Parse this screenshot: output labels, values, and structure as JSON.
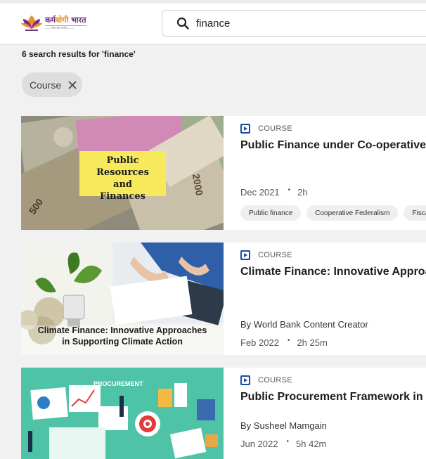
{
  "header": {
    "logo_title_a": "कर्म",
    "logo_title_b": "योगी",
    "logo_title_c": " भारत",
    "logo_subtitle": "—— सेवा और कर्तव्य ——",
    "search": {
      "value": "finance",
      "placeholder": "Search"
    }
  },
  "results": {
    "summary": "6 search results for 'finance'"
  },
  "filters": [
    {
      "label": "Course"
    }
  ],
  "cards": [
    {
      "type": "COURSE",
      "title": "Public Finance under Co-operative Federalism",
      "image_caption": [
        "Public Resources",
        "and",
        "Finances"
      ],
      "author": "",
      "date": "Dec 2021",
      "duration": "2h",
      "tags": [
        "Public finance",
        "Cooperative Federalism",
        "Fiscal"
      ]
    },
    {
      "type": "COURSE",
      "title": "Climate Finance: Innovative Approaches in Supporting Climate Action",
      "image_caption": [
        "Climate Finance: Innovative Approaches",
        "in Supporting Climate Action"
      ],
      "author": "By World Bank Content Creator",
      "date": "Feb 2022",
      "duration": "2h 25m",
      "tags": []
    },
    {
      "type": "COURSE",
      "title": "Public Procurement Framework in India",
      "image_caption": [
        "PROCUREMENT"
      ],
      "author": "By Susheel Mamgain",
      "date": "Jun 2022",
      "duration": "5h 42m",
      "tags": []
    }
  ],
  "colors": {
    "accent": "#1a4fa0",
    "background": "#f1f1f1",
    "chip": "#dedede"
  },
  "icons": {
    "search": "search-icon",
    "close": "close-icon",
    "course_type": "play-icon"
  }
}
